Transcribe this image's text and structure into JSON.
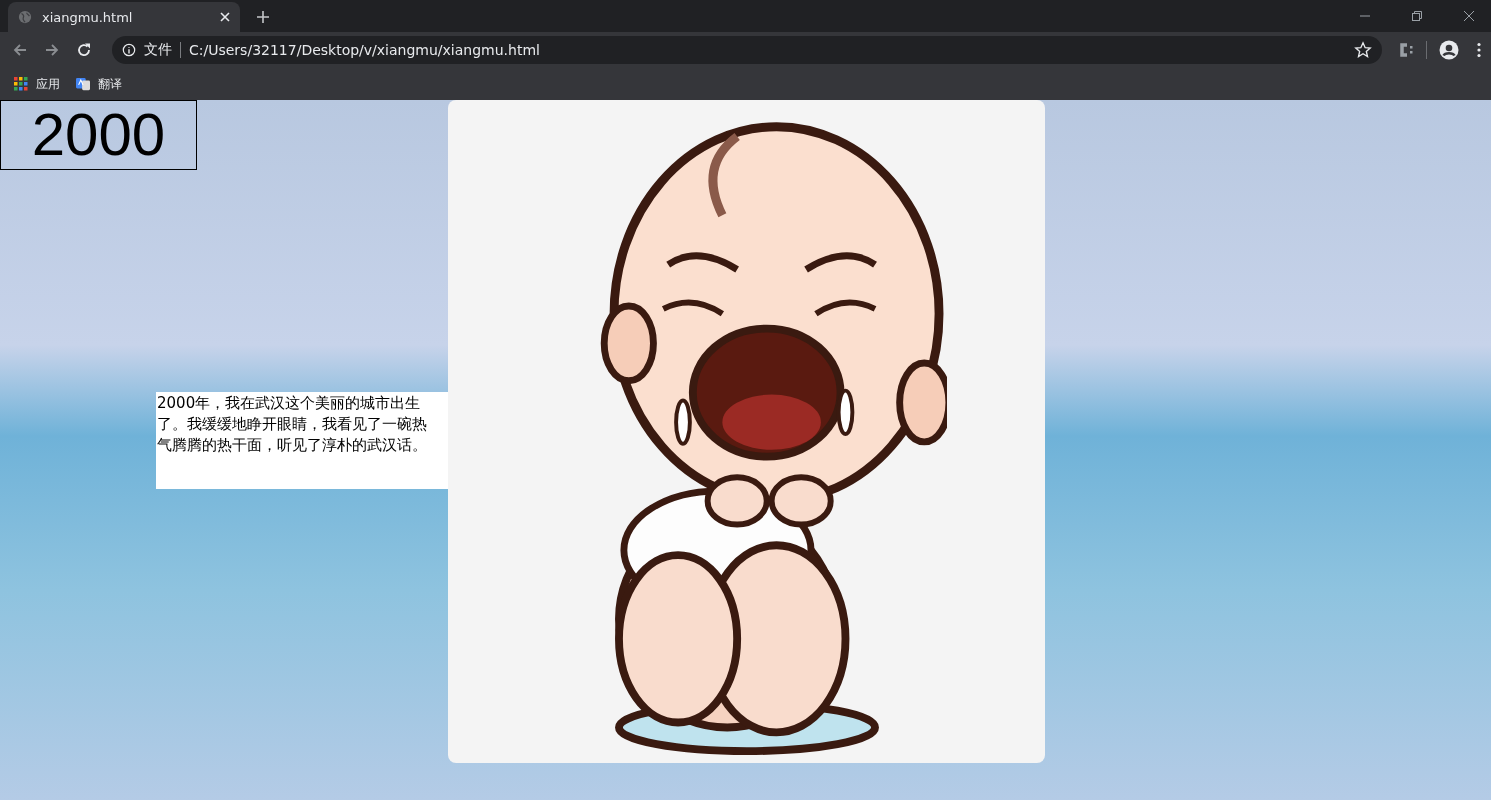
{
  "browser": {
    "tab": {
      "title": "xiangmu.html",
      "selected": true
    },
    "address": {
      "scheme_label": "文件",
      "url": "C:/Users/32117/Desktop/v/xiangmu/xiangmu.html"
    },
    "bookmarks": [
      {
        "label": "应用",
        "kind": "apps"
      },
      {
        "label": "翻译",
        "kind": "translate"
      }
    ]
  },
  "page": {
    "year": "2000",
    "story": "2000年，我在武汉这个美丽的城市出生了。我缓缓地睁开眼睛，我看见了一碗热气腾腾的热干面，听见了淳朴的武汉话。"
  }
}
